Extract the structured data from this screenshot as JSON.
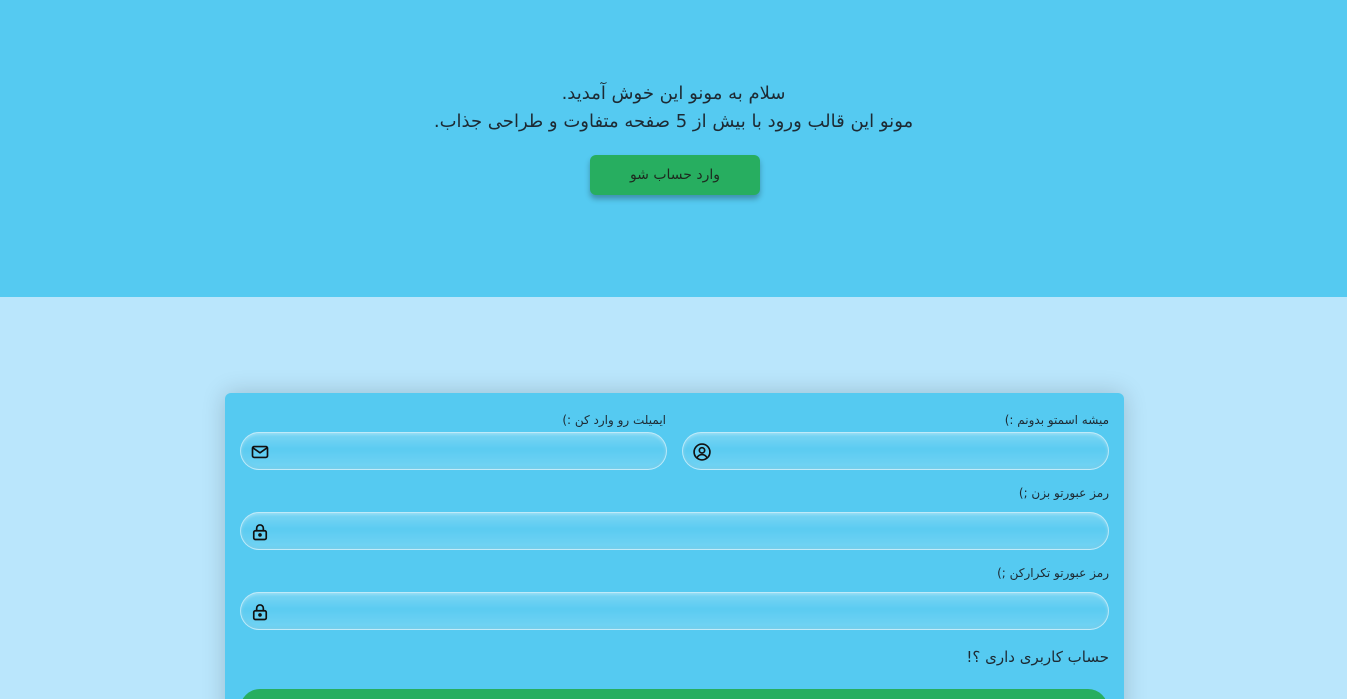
{
  "hero": {
    "line1": "سلام به مونو این خوش آمدید.",
    "line2": "مونو این قالب ورود با بیش از 5 صفحه متفاوت و طراحی جذاب.",
    "login_button_label": "وارد حساب شو"
  },
  "form": {
    "name_label": "میشه اسمتو بدونم :)",
    "email_label": "ایمیلت رو وارد کن :)",
    "password_label": "رمز عبورتو بزن ;)",
    "password_repeat_label": "رمز عبورتو تکرارکن ;)",
    "have_account_link": "حساب کاربری داری ؟!",
    "name_value": "",
    "email_value": "",
    "password_value": "",
    "password_repeat_value": ""
  },
  "colors": {
    "hero_bg": "#55caf1",
    "page_bg": "#bae6fc",
    "card_bg": "#55caf1",
    "accent_green": "#27ae60"
  },
  "icons": {
    "name_field": "user-circle-icon",
    "email_field": "envelope-icon",
    "password_field": "lock-icon",
    "password_repeat_field": "lock-icon"
  }
}
